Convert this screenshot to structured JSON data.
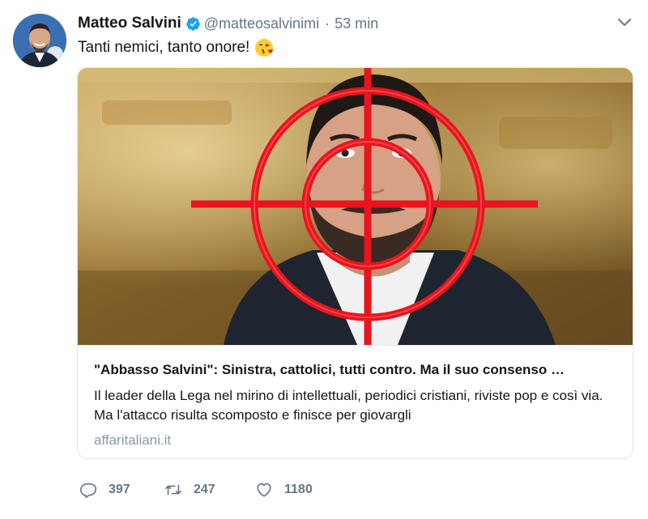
{
  "tweet": {
    "author_name": "Matteo Salvini",
    "handle": "@matteosalvinimi",
    "separator": "·",
    "time": "53 min",
    "text": "Tanti nemici, tanto onore!",
    "emoji": "face-throwing-kiss-emoji",
    "verified": true
  },
  "card": {
    "title": "\"Abbasso Salvini\": Sinistra, cattolici, tutti contro. Ma il suo consenso …",
    "description": "Il leader della Lega nel mirino di intellettuali, periodici cristiani, riviste pop e così via. Ma l'attacco risulta scomposto e finisce per giovargli",
    "domain": "affaritaliani.it"
  },
  "actions": {
    "replies": "397",
    "retweets": "247",
    "likes": "1180"
  },
  "colors": {
    "verified": "#1da1f2",
    "muted": "#657786",
    "border": "#e1e8ed",
    "crosshair": "#e8141e"
  },
  "icons": [
    "verified-badge-icon",
    "chevron-down-icon",
    "reply-icon",
    "retweet-icon",
    "like-icon"
  ]
}
